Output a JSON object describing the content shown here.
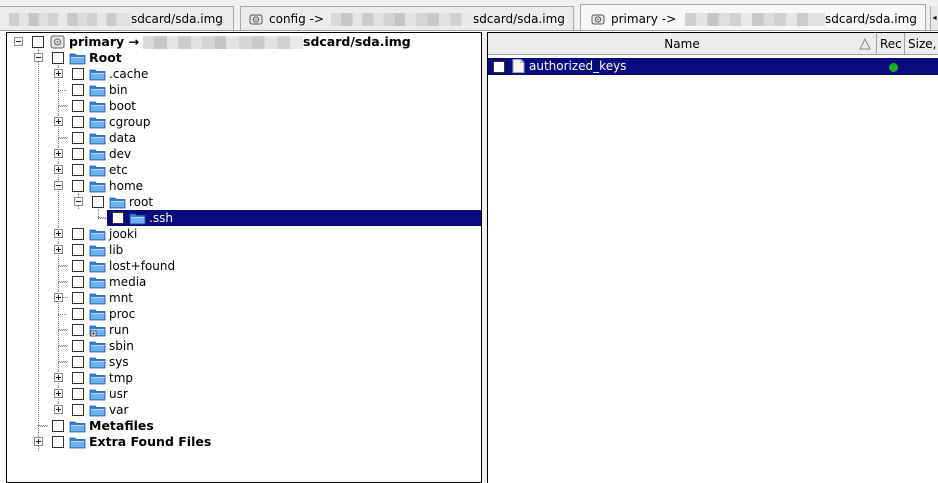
{
  "tabs": [
    {
      "label": "sdcard/sda.img",
      "prefix": "",
      "icon": "drive-icon",
      "active": false
    },
    {
      "label": "config ->",
      "icon": "drive-icon",
      "active": false
    },
    {
      "label": "sdcard/sda.img",
      "prefix": "",
      "icon": "",
      "active": false
    },
    {
      "label": "primary ->",
      "icon": "drive-icon",
      "active": true
    },
    {
      "label": "sdcard/sda.img",
      "icon": "",
      "active": true
    }
  ],
  "tree": {
    "root_label": "primary →",
    "root_suffix": "sdcard/sda.img",
    "items": [
      {
        "label": "Root",
        "bold": true
      },
      {
        "label": ".cache"
      },
      {
        "label": "bin"
      },
      {
        "label": "boot"
      },
      {
        "label": "cgroup"
      },
      {
        "label": "data"
      },
      {
        "label": "dev"
      },
      {
        "label": "etc"
      },
      {
        "label": "home"
      },
      {
        "label": "root"
      },
      {
        "label": ".ssh",
        "selected": true
      },
      {
        "label": "jooki"
      },
      {
        "label": "lib"
      },
      {
        "label": "lost+found"
      },
      {
        "label": "media"
      },
      {
        "label": "mnt"
      },
      {
        "label": "proc"
      },
      {
        "label": "run"
      },
      {
        "label": "sbin"
      },
      {
        "label": "sys"
      },
      {
        "label": "tmp"
      },
      {
        "label": "usr"
      },
      {
        "label": "var"
      },
      {
        "label": "Metafiles",
        "bold": true
      },
      {
        "label": "Extra Found Files",
        "bold": true
      }
    ]
  },
  "list": {
    "columns": [
      "Name",
      "Rec",
      "Size,"
    ],
    "sort_column": "Name",
    "rows": [
      {
        "name": "authorized_keys",
        "status_color": "#1ab31a"
      }
    ]
  },
  "colors": {
    "selection": "#0a0a80",
    "folder": "#3a8ee6",
    "status_ok": "#1ab31a"
  }
}
